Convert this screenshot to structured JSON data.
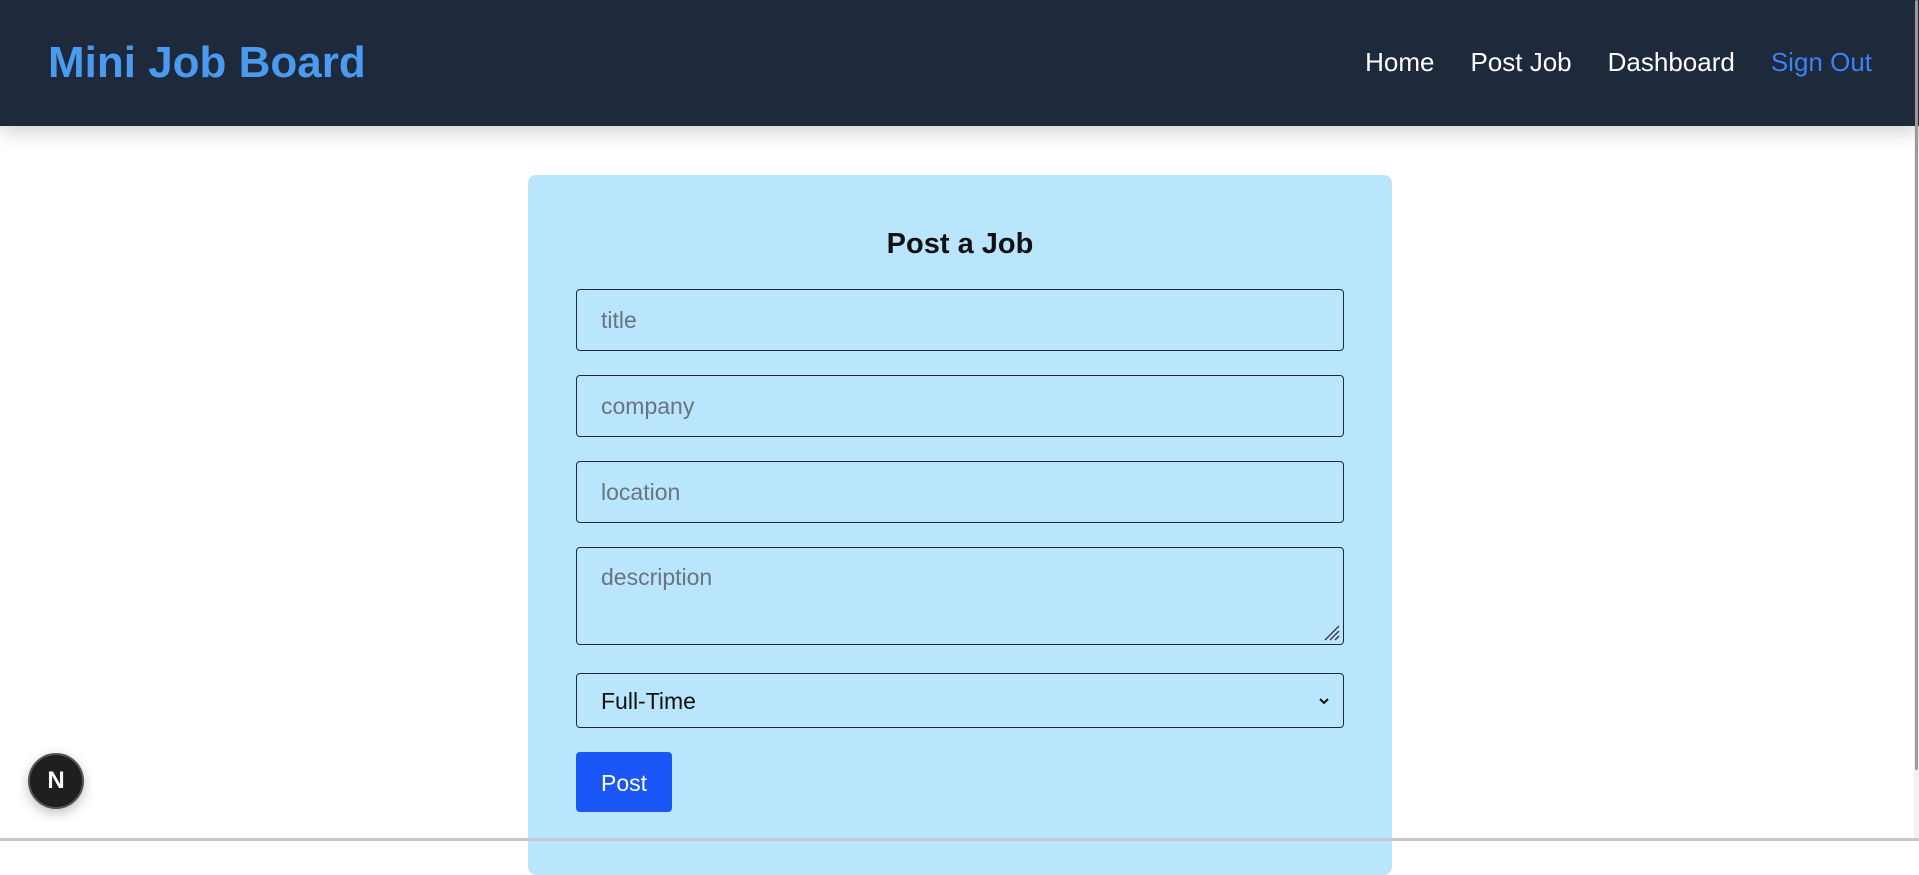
{
  "header": {
    "brand": "Mini Job Board",
    "nav": [
      {
        "label": "Home"
      },
      {
        "label": "Post Job"
      },
      {
        "label": "Dashboard"
      },
      {
        "label": "Sign Out"
      }
    ]
  },
  "form": {
    "heading": "Post a Job",
    "title_placeholder": "title",
    "company_placeholder": "company",
    "location_placeholder": "location",
    "description_placeholder": "description",
    "job_type_selected": "Full-Time",
    "submit_label": "Post"
  },
  "badge": {
    "letter": "N"
  },
  "colors": {
    "navbar_bg": "#1e293b",
    "brand": "#4a9bf0",
    "sign_out": "#3b82f6",
    "card_bg": "#bae6fd",
    "button_bg": "#1a56f5"
  }
}
